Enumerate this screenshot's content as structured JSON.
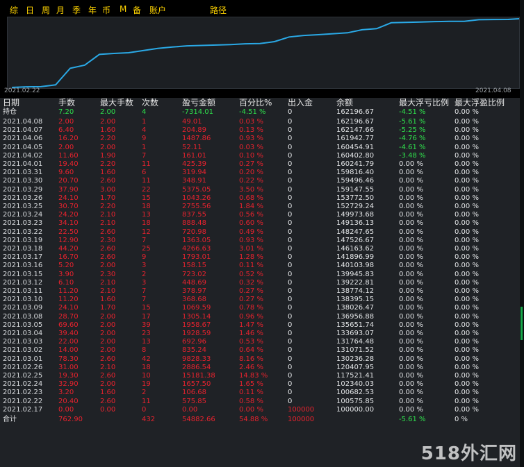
{
  "tabs": [
    "综",
    "日",
    "周",
    "月",
    "季",
    "年",
    "币",
    "M",
    "备",
    "账户",
    "路径"
  ],
  "chart": {
    "start_label": "2021.02.22",
    "end_label": "2021.04.08",
    "line_color": "#2aa9e6",
    "balance_series": [
      100000.0,
      100575.85,
      100682.53,
      102340.03,
      117521.41,
      120407.95,
      130236.28,
      131071.52,
      131764.48,
      133693.07,
      135651.74,
      136956.88,
      138026.47,
      138395.15,
      138774.12,
      139222.81,
      139945.83,
      140103.98,
      141896.99,
      146163.62,
      147526.67,
      148247.65,
      149136.13,
      149973.68,
      152729.24,
      153772.5,
      159147.55,
      159496.46,
      159816.4,
      160241.79,
      160402.8,
      160454.91,
      161942.77,
      162147.66,
      162196.67
    ]
  },
  "table": {
    "headers": [
      "日期",
      "手数",
      "最大手数",
      "次数",
      "盈亏金额",
      "百分比%",
      "出入金",
      "余额",
      "最大浮亏比例",
      "最大浮盈比例"
    ],
    "holding": [
      "持仓",
      "7.20",
      "2.00",
      "4",
      "-7314.01",
      "-4.51 %",
      "0",
      "162196.67",
      "-4.51 %",
      "0.00 %"
    ],
    "rows": [
      [
        "2021.04.08",
        "2.00",
        "2.00",
        "1",
        "49.01",
        "0.03 %",
        "0",
        "162196.67",
        "-5.61 %",
        "0.00 %"
      ],
      [
        "2021.04.07",
        "6.40",
        "1.60",
        "4",
        "204.89",
        "0.13 %",
        "0",
        "162147.66",
        "-5.25 %",
        "0.00 %"
      ],
      [
        "2021.04.06",
        "16.20",
        "2.20",
        "9",
        "1487.86",
        "0.93 %",
        "0",
        "161942.77",
        "-4.76 %",
        "0.00 %"
      ],
      [
        "2021.04.05",
        "2.00",
        "2.00",
        "1",
        "52.11",
        "0.03 %",
        "0",
        "160454.91",
        "-4.61 %",
        "0.00 %"
      ],
      [
        "2021.04.02",
        "11.60",
        "1.90",
        "7",
        "161.01",
        "0.10 %",
        "0",
        "160402.80",
        "-3.48 %",
        "0.00 %"
      ],
      [
        "2021.04.01",
        "19.40",
        "2.20",
        "11",
        "425.39",
        "0.27 %",
        "0",
        "160241.79",
        "0.00 %",
        "0.00 %"
      ],
      [
        "2021.03.31",
        "9.60",
        "1.60",
        "6",
        "319.94",
        "0.20 %",
        "0",
        "159816.40",
        "0.00 %",
        "0.00 %"
      ],
      [
        "2021.03.30",
        "20.70",
        "2.60",
        "11",
        "348.91",
        "0.22 %",
        "0",
        "159496.46",
        "0.00 %",
        "0.00 %"
      ],
      [
        "2021.03.29",
        "37.90",
        "3.00",
        "22",
        "5375.05",
        "3.50 %",
        "0",
        "159147.55",
        "0.00 %",
        "0.00 %"
      ],
      [
        "2021.03.26",
        "24.10",
        "1.70",
        "15",
        "1043.26",
        "0.68 %",
        "0",
        "153772.50",
        "0.00 %",
        "0.00 %"
      ],
      [
        "2021.03.25",
        "30.70",
        "2.20",
        "18",
        "2755.56",
        "1.84 %",
        "0",
        "152729.24",
        "0.00 %",
        "0.00 %"
      ],
      [
        "2021.03.24",
        "24.20",
        "2.10",
        "13",
        "837.55",
        "0.56 %",
        "0",
        "149973.68",
        "0.00 %",
        "0.00 %"
      ],
      [
        "2021.03.23",
        "34.10",
        "2.10",
        "18",
        "888.48",
        "0.60 %",
        "0",
        "149136.13",
        "0.00 %",
        "0.00 %"
      ],
      [
        "2021.03.22",
        "22.50",
        "2.60",
        "12",
        "720.98",
        "0.49 %",
        "0",
        "148247.65",
        "0.00 %",
        "0.00 %"
      ],
      [
        "2021.03.19",
        "12.90",
        "2.30",
        "7",
        "1363.05",
        "0.93 %",
        "0",
        "147526.67",
        "0.00 %",
        "0.00 %"
      ],
      [
        "2021.03.18",
        "44.20",
        "2.60",
        "25",
        "4266.63",
        "3.01 %",
        "0",
        "146163.62",
        "0.00 %",
        "0.00 %"
      ],
      [
        "2021.03.17",
        "16.70",
        "2.60",
        "9",
        "1793.01",
        "1.28 %",
        "0",
        "141896.99",
        "0.00 %",
        "0.00 %"
      ],
      [
        "2021.03.16",
        "5.20",
        "2.00",
        "3",
        "158.15",
        "0.11 %",
        "0",
        "140103.98",
        "0.00 %",
        "0.00 %"
      ],
      [
        "2021.03.15",
        "3.90",
        "2.30",
        "2",
        "723.02",
        "0.52 %",
        "0",
        "139945.83",
        "0.00 %",
        "0.00 %"
      ],
      [
        "2021.03.12",
        "6.10",
        "2.10",
        "3",
        "448.69",
        "0.32 %",
        "0",
        "139222.81",
        "0.00 %",
        "0.00 %"
      ],
      [
        "2021.03.11",
        "11.20",
        "2.10",
        "7",
        "378.97",
        "0.27 %",
        "0",
        "138774.12",
        "0.00 %",
        "0.00 %"
      ],
      [
        "2021.03.10",
        "11.20",
        "1.60",
        "7",
        "368.68",
        "0.27 %",
        "0",
        "138395.15",
        "0.00 %",
        "0.00 %"
      ],
      [
        "2021.03.09",
        "24.10",
        "1.70",
        "15",
        "1069.59",
        "0.78 %",
        "0",
        "138026.47",
        "0.00 %",
        "0.00 %"
      ],
      [
        "2021.03.08",
        "28.70",
        "2.00",
        "17",
        "1305.14",
        "0.96 %",
        "0",
        "136956.88",
        "0.00 %",
        "0.00 %"
      ],
      [
        "2021.03.05",
        "69.60",
        "2.00",
        "39",
        "1958.67",
        "1.47 %",
        "0",
        "135651.74",
        "0.00 %",
        "0.00 %"
      ],
      [
        "2021.03.04",
        "39.40",
        "2.00",
        "23",
        "1928.59",
        "1.46 %",
        "0",
        "133693.07",
        "0.00 %",
        "0.00 %"
      ],
      [
        "2021.03.03",
        "22.00",
        "2.00",
        "13",
        "692.96",
        "0.53 %",
        "0",
        "131764.48",
        "0.00 %",
        "0.00 %"
      ],
      [
        "2021.03.02",
        "14.00",
        "2.00",
        "8",
        "835.24",
        "0.64 %",
        "0",
        "131071.52",
        "0.00 %",
        "0.00 %"
      ],
      [
        "2021.03.01",
        "78.30",
        "2.60",
        "42",
        "9828.33",
        "8.16 %",
        "0",
        "130236.28",
        "0.00 %",
        "0.00 %"
      ],
      [
        "2021.02.26",
        "31.00",
        "2.10",
        "18",
        "2886.54",
        "2.46 %",
        "0",
        "120407.95",
        "0.00 %",
        "0.00 %"
      ],
      [
        "2021.02.25",
        "19.30",
        "2.60",
        "10",
        "15181.38",
        "14.83 %",
        "0",
        "117521.41",
        "0.00 %",
        "0.00 %"
      ],
      [
        "2021.02.24",
        "32.90",
        "2.00",
        "19",
        "1657.50",
        "1.65 %",
        "0",
        "102340.03",
        "0.00 %",
        "0.00 %"
      ],
      [
        "2021.02.23",
        "3.20",
        "1.60",
        "2",
        "106.68",
        "0.11 %",
        "0",
        "100682.53",
        "0.00 %",
        "0.00 %"
      ],
      [
        "2021.02.22",
        "20.40",
        "2.60",
        "11",
        "575.85",
        "0.58 %",
        "0",
        "100575.85",
        "0.00 %",
        "0.00 %"
      ],
      [
        "2021.02.17",
        "0.00",
        "0.00",
        "0",
        "0.00",
        "0.00 %",
        "100000",
        "100000.00",
        "0.00 %",
        "0.00 %"
      ]
    ],
    "total": [
      "合计",
      "762.90",
      "",
      "432",
      "54882.66",
      "54.88 %",
      "100000",
      "",
      "-5.61 %",
      "0 %"
    ]
  },
  "watermark": "518外汇网",
  "colors": {
    "positive": "#e8222e",
    "negative": "#2fe04c",
    "neutral": "#e2e4e6",
    "tab": "#ffd400"
  }
}
